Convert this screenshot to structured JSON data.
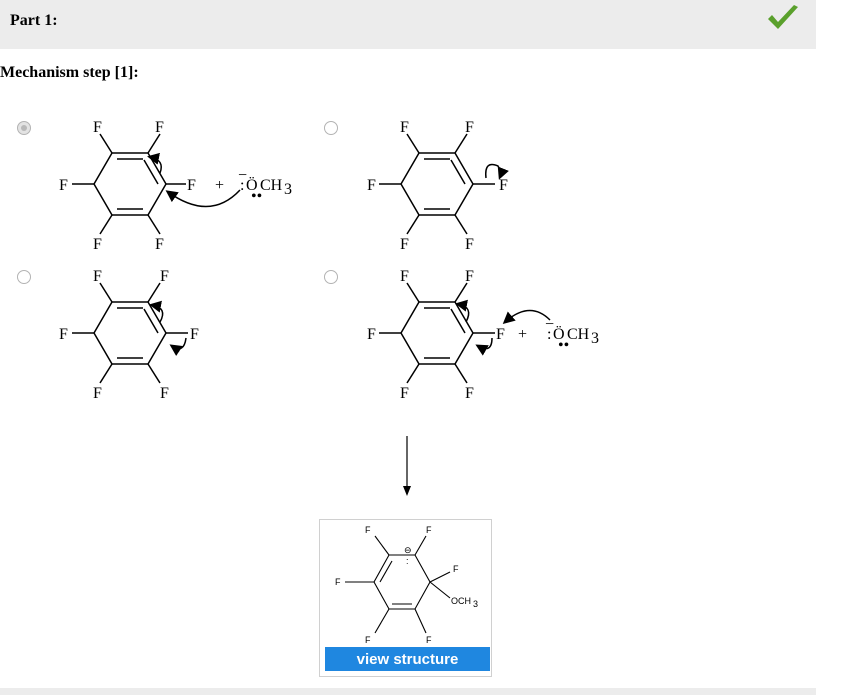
{
  "part": {
    "title": "Part 1:"
  },
  "step": {
    "title": "Mechanism step [1]:"
  },
  "atoms": {
    "F": "F",
    "OCH3_O": "Ö",
    "OCH3_C": "CH",
    "OCH3_sub": "3",
    "plus": "+",
    "minus": "−",
    "lonepair": "••",
    "colon": ":"
  },
  "options": [
    {
      "id": "A",
      "selected": true
    },
    {
      "id": "B",
      "selected": false
    },
    {
      "id": "C",
      "selected": false
    },
    {
      "id": "D",
      "selected": false
    }
  ],
  "product": {
    "labels": {
      "F": "F",
      "OCH": "OCH",
      "sub3": "3",
      "charge": "⊖",
      "lp": ":"
    },
    "button_label": "view structure"
  },
  "colors": {
    "check": "#5aa02c",
    "button": "#1f87e0",
    "header": "#ececec"
  }
}
